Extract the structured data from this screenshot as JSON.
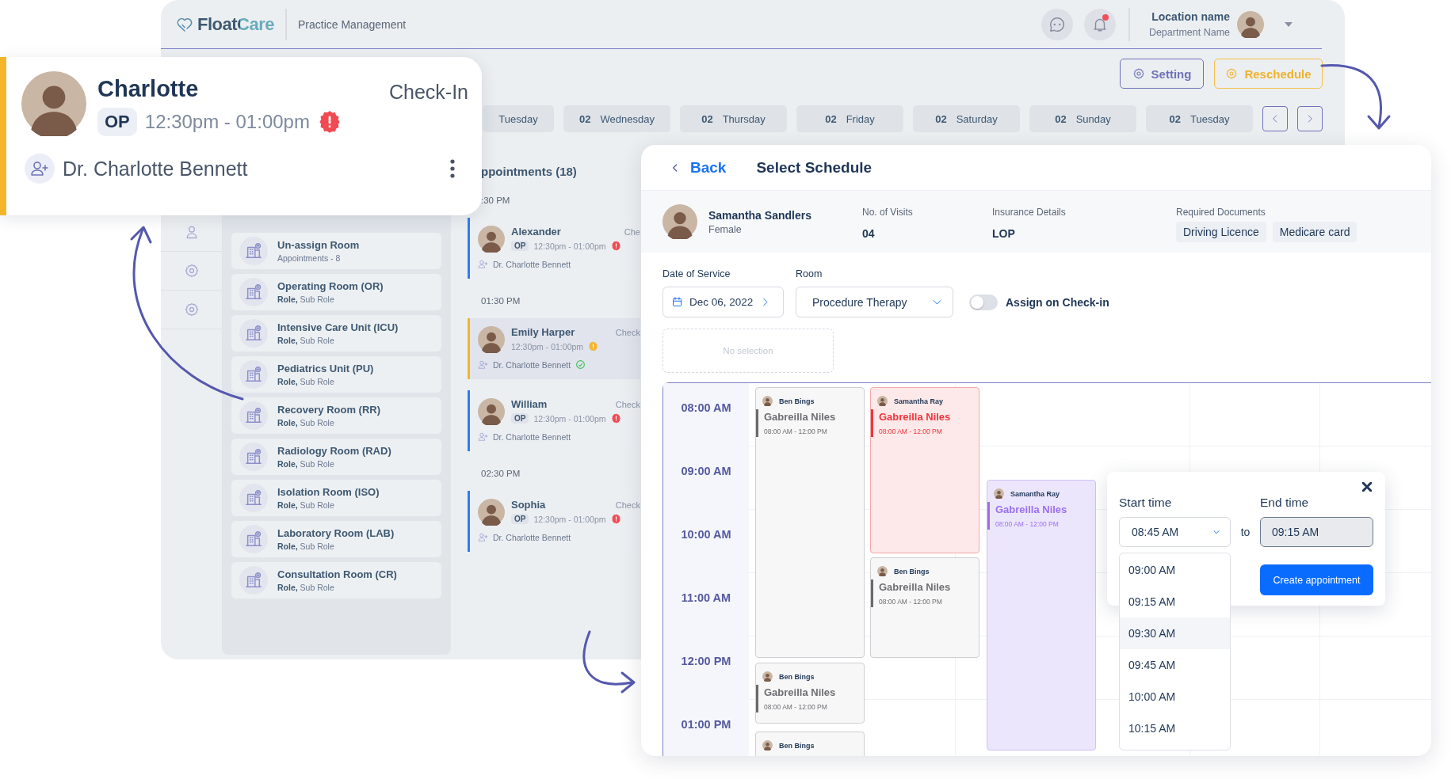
{
  "header": {
    "logo": "FloatCare",
    "subtitle": "Practice Management",
    "notification_dot": true,
    "location_name": "Location name",
    "department": "Department Name"
  },
  "actions": [
    {
      "label": "Setting",
      "kind": "outline"
    },
    {
      "label": "Reschedule",
      "kind": "highlight"
    }
  ],
  "day_tabs": [
    {
      "weekday": "Tuesday"
    },
    {
      "date": "02",
      "weekday": "Wednesday"
    },
    {
      "date": "02",
      "weekday": "Thursday"
    },
    {
      "date": "02",
      "weekday": "Friday"
    },
    {
      "date": "02",
      "weekday": "Saturday"
    },
    {
      "date": "02",
      "weekday": "Sunday"
    },
    {
      "date": "02",
      "weekday": "Tuesday"
    }
  ],
  "rooms": [
    {
      "name": "Un-assign Room",
      "detail": "Appointments - 8"
    },
    {
      "name": "Operating Room (OR)",
      "detail": "**Role,** Sub Role"
    },
    {
      "name": "Intensive Care Unit (ICU)",
      "detail": "**Role,** Sub Role"
    },
    {
      "name": "Pediatrics Unit (PU)",
      "detail": "**Role,** Sub Role"
    },
    {
      "name": "Recovery Room (RR)",
      "detail": "**Role,** Sub Role"
    },
    {
      "name": "Radiology Room (RAD)",
      "detail": "**Role,** Sub Role"
    },
    {
      "name": "Isolation Room (ISO)",
      "detail": "**Role,** Sub Role"
    },
    {
      "name": "Laboratory Room (LAB)",
      "detail": "**Role,** Sub Role"
    },
    {
      "name": "Consultation Room (CR)",
      "detail": "**Role,** Sub Role"
    }
  ],
  "appointments": {
    "title": "ppointments (18)",
    "groups": [
      {
        "time": ":30 PM",
        "items": [
          {
            "name": "Alexander",
            "status": "Che",
            "badge": "OP",
            "time": "12:30pm - 01:00pm",
            "alert": {
              "color": "#f04a52"
            },
            "doctor": "Dr. Charlotte Bennett",
            "doctor_check": false,
            "selected": false
          }
        ]
      },
      {
        "time": "01:30 PM",
        "items": [
          {
            "name": "Emily Harper",
            "status": "Check",
            "time": "12:30pm - 01:00pm",
            "alert": {
              "color": "#f3b52d"
            },
            "doctor": "Dr. Charlotte Bennett",
            "doctor_check": true,
            "selected": true
          },
          {
            "name": "William",
            "status": "Check",
            "badge": "OP",
            "time": "12:30pm - 01:00pm",
            "alert": {
              "color": "#f04a52"
            },
            "doctor": "Dr. Charlotte Bennett",
            "doctor_check": false,
            "selected": false
          }
        ]
      },
      {
        "time": "02:30 PM",
        "items": [
          {
            "name": "Sophia",
            "status": "Check",
            "badge": "OP",
            "time": "12:30pm - 01:00pm",
            "alert": {
              "color": "#f04a52"
            },
            "doctor": "Dr. Charlotte Bennett",
            "doctor_check": false,
            "selected": false
          }
        ]
      }
    ]
  },
  "popup_card": {
    "name": "Charlotte",
    "status": "Check-In",
    "badge": "OP",
    "time": "12:30pm - 01:00pm",
    "alert": {
      "color": "#f04a52"
    },
    "doctor": "Dr. Charlotte Bennett"
  },
  "schedule": {
    "back": "Back",
    "title": "Select Schedule",
    "patient": {
      "name": "Samantha Sandlers",
      "gender": "Female"
    },
    "info": [
      {
        "label": "No. of Visits",
        "value": "04"
      },
      {
        "label": "Insurance Details",
        "value": "LOP"
      }
    ],
    "documents": {
      "label": "Required Documents",
      "items": [
        "Driving Licence",
        "Medicare card"
      ]
    },
    "date": {
      "label": "Date of Service",
      "value": "Dec 06, 2022"
    },
    "room": {
      "label": "Room",
      "value": "Procedure Therapy"
    },
    "assign_toggle": {
      "label": "Assign on Check-in",
      "on": false
    },
    "empty_slot": "No selection",
    "hours": [
      "08:00 AM",
      "09:00 AM",
      "10:00 AM",
      "11:00 AM",
      "12:00 PM",
      "01:00 PM"
    ],
    "events": [
      {
        "owner": "Ben Bings",
        "title": "Gabreilla Niles",
        "time": "08:00 AM - 12:00 PM",
        "kind": "default"
      },
      {
        "owner": "Ben Bings",
        "title": "Gabreilla Niles",
        "time": "08:00 AM - 12:00 PM",
        "kind": "default"
      },
      {
        "owner": "Ben Bings",
        "kind": "default"
      },
      {
        "owner": "Samantha Ray",
        "title": "Gabreilla Niles",
        "time": "08:00 AM - 12:00 PM",
        "kind": "alert"
      },
      {
        "owner": "Ben Bings",
        "title": "Gabreilla Niles",
        "time": "08:00 AM - 12:00 PM",
        "kind": "default"
      },
      {
        "owner": "Samantha Ray",
        "title": "Gabreilla Niles",
        "time": "08:00 AM - 12:00 PM",
        "kind": "tentative"
      }
    ],
    "time_picker": {
      "start_label": "Start time",
      "start_value": "08:45 AM",
      "separator": "to",
      "end_label": "End time",
      "end_value": "09:15 AM",
      "options": [
        {
          "label": "09:00 AM",
          "selected": false
        },
        {
          "label": "09:15 AM",
          "selected": false
        },
        {
          "label": "09:30 AM",
          "selected": true
        },
        {
          "label": "09:45 AM",
          "selected": false
        },
        {
          "label": "10:00 AM",
          "selected": false
        },
        {
          "label": "10:15 AM",
          "selected": false
        }
      ],
      "button": "Create appointment"
    }
  }
}
